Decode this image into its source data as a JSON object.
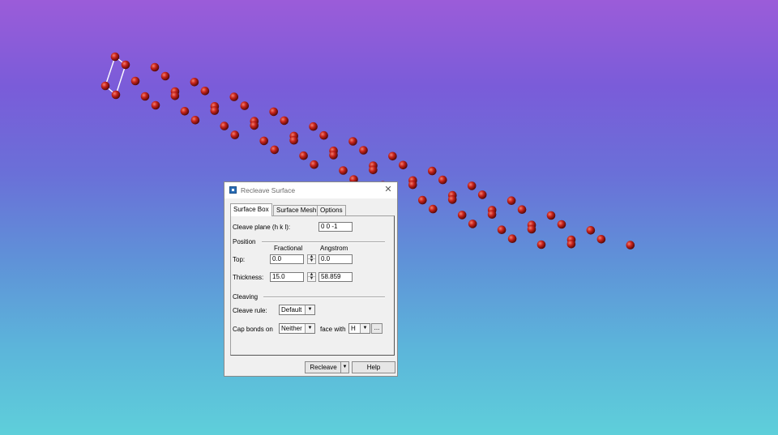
{
  "colors": {
    "background_top": "#9b5cd9",
    "background_bottom": "#5ecfda",
    "atom": "#c8231c",
    "bond": "#ffffff"
  },
  "dialog": {
    "title": "Recleave Surface",
    "tabs": [
      {
        "label": "Surface Box",
        "active": true
      },
      {
        "label": "Surface Mesh",
        "active": false
      },
      {
        "label": "Options",
        "active": false
      }
    ],
    "cleave_plane": {
      "label": "Cleave plane (h k l):",
      "value": "0  0  -1"
    },
    "position": {
      "section_label": "Position",
      "col_fractional": "Fractional",
      "col_angstrom": "Angstrom",
      "top": {
        "label": "Top:",
        "fractional": "0.0",
        "angstrom": "0.0"
      },
      "thickness": {
        "label": "Thickness:",
        "fractional": "15.0",
        "angstrom": "58.859"
      }
    },
    "cleaving": {
      "section_label": "Cleaving",
      "rule_label": "Cleave rule:",
      "rule_value": "Default",
      "cap_label": "Cap bonds on",
      "cap_value": "Neither",
      "face_label": "face with",
      "face_value": "H",
      "browse_label": "..."
    },
    "buttons": {
      "recleave": "Recleave",
      "help": "Help"
    }
  }
}
